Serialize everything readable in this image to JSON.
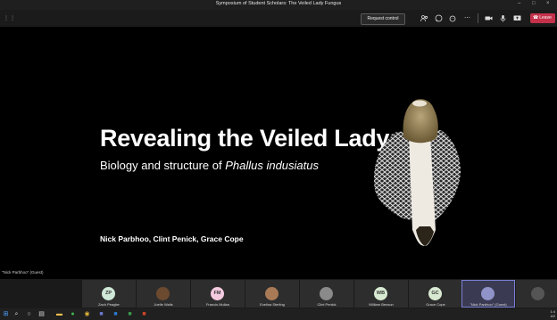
{
  "window": {
    "title": "Symposium of Student Scholars: The Veiled Lady Fungus",
    "controls": [
      "–",
      "□",
      "×"
    ]
  },
  "toolbar": {
    "request_control": "Request control",
    "leave": "Leave",
    "icons": [
      "people-icon",
      "chat-icon",
      "react-icon",
      "more-icon",
      "camera-icon",
      "mic-icon",
      "share-icon"
    ]
  },
  "slide": {
    "title": "Revealing the Veiled Lady:",
    "subtitle_prefix": "Biology and structure of ",
    "subtitle_species": "Phallus indusiatus",
    "authors": "Nick Parbhoo, Clint Penick, Grace Cope"
  },
  "presenter_label": "\"Nick Parbhoo\" (Guest)",
  "participants": [
    {
      "name": "Zach Peagler",
      "initials": "ZP",
      "color": "#cfe8d8",
      "photo": false
    },
    {
      "name": "Joelle Walls",
      "initials": "",
      "color": "#6b4a2f",
      "photo": true
    },
    {
      "name": "Francis Mullan",
      "initials": "FM",
      "color": "#f3cbe0",
      "photo": false
    },
    {
      "name": "Evelina Sterling",
      "initials": "",
      "color": "#a87a55",
      "photo": true
    },
    {
      "name": "Clint Penick",
      "initials": "",
      "color": "#8a8a8a",
      "photo": true
    },
    {
      "name": "William Benson",
      "initials": "WB",
      "color": "#d8ead2",
      "photo": false
    },
    {
      "name": "Grace Cope",
      "initials": "GC",
      "color": "#d8ead2",
      "photo": false
    },
    {
      "name": "\"Nick Parbhoo\" (Guest)",
      "initials": "",
      "color": "#8f93c8",
      "photo": true
    }
  ],
  "taskbar": {
    "time": "1:4",
    "date": "4/2"
  }
}
